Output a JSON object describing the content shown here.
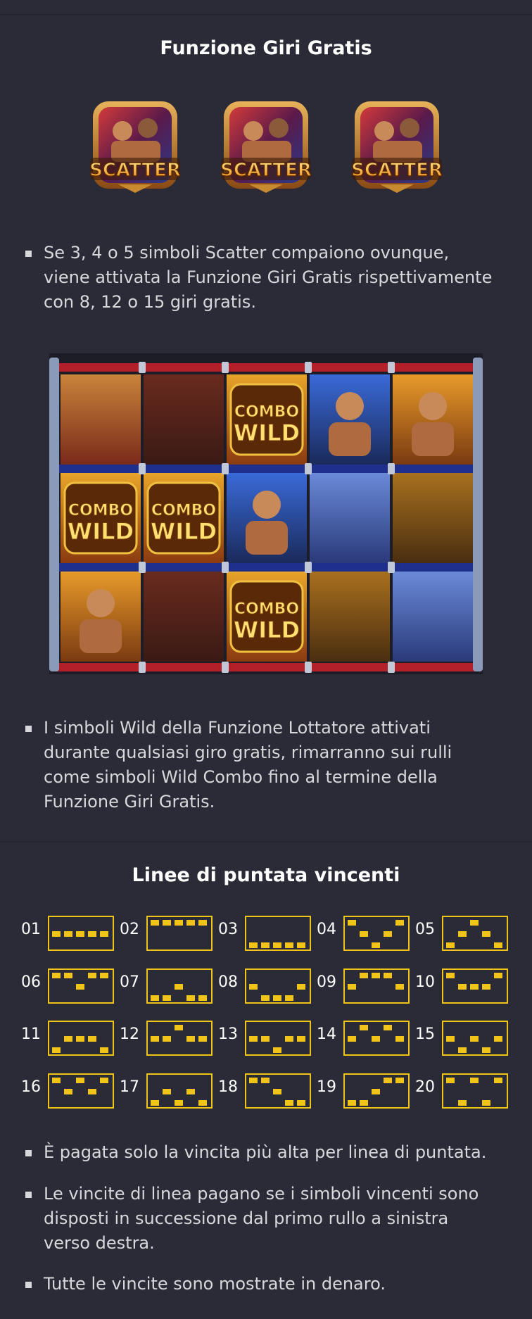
{
  "free_spins": {
    "title": "Funzione Giri Gratis",
    "scatter_symbols": [
      {
        "label": "SCATTER",
        "icon": "scatter-symbol-icon"
      },
      {
        "label": "SCATTER",
        "icon": "scatter-symbol-icon"
      },
      {
        "label": "SCATTER",
        "icon": "scatter-symbol-icon"
      }
    ],
    "bullets": [
      [
        "Se 3, 4 o 5 simboli Scatter compaiono ovunque,",
        "viene attivata la Funzione Giri Gratis rispettivamente",
        "con 8, 12 o 15 giri gratis."
      ],
      [
        "I simboli Wild della Funzione Lottatore attivati",
        "durante qualsiasi giro gratis, rimarranno sui rulli",
        "come simboli Wild Combo fino al termine della",
        "Funzione Giri Gratis."
      ]
    ],
    "reels": {
      "combo_line1": "COMBO",
      "combo_line2": "WILD",
      "grid": [
        [
          "blur-red",
          "blur-dark",
          "wild",
          "fighter-blue",
          "fighter-red"
        ],
        [
          "wild",
          "wild",
          "fighter-blue",
          "blur-blue",
          "blur-gold"
        ],
        [
          "fighter-red",
          "blur-dark",
          "wild",
          "blur-gold",
          "blur-blue"
        ]
      ],
      "colors": {
        "rope_red": "#b3202a",
        "rope_blue": "#1f2f8c",
        "post": "#8a9ab8"
      }
    }
  },
  "paylines": {
    "title": "Linee di puntata vincenti",
    "color": "#f0c419",
    "items": [
      {
        "number": "01",
        "rows": [
          1,
          1,
          1,
          1,
          1
        ]
      },
      {
        "number": "02",
        "rows": [
          0,
          0,
          0,
          0,
          0
        ]
      },
      {
        "number": "03",
        "rows": [
          2,
          2,
          2,
          2,
          2
        ]
      },
      {
        "number": "04",
        "rows": [
          0,
          1,
          2,
          1,
          0
        ]
      },
      {
        "number": "05",
        "rows": [
          2,
          1,
          0,
          1,
          2
        ]
      },
      {
        "number": "06",
        "rows": [
          0,
          0,
          1,
          0,
          0
        ]
      },
      {
        "number": "07",
        "rows": [
          2,
          2,
          1,
          2,
          2
        ]
      },
      {
        "number": "08",
        "rows": [
          1,
          2,
          2,
          2,
          1
        ]
      },
      {
        "number": "09",
        "rows": [
          1,
          0,
          0,
          0,
          1
        ]
      },
      {
        "number": "10",
        "rows": [
          0,
          1,
          1,
          1,
          0
        ]
      },
      {
        "number": "11",
        "rows": [
          2,
          1,
          1,
          1,
          2
        ]
      },
      {
        "number": "12",
        "rows": [
          1,
          1,
          0,
          1,
          1
        ]
      },
      {
        "number": "13",
        "rows": [
          1,
          1,
          2,
          1,
          1
        ]
      },
      {
        "number": "14",
        "rows": [
          1,
          0,
          1,
          0,
          1
        ]
      },
      {
        "number": "15",
        "rows": [
          1,
          2,
          1,
          2,
          1
        ]
      },
      {
        "number": "16",
        "rows": [
          0,
          1,
          0,
          1,
          0
        ]
      },
      {
        "number": "17",
        "rows": [
          2,
          1,
          2,
          1,
          2
        ]
      },
      {
        "number": "18",
        "rows": [
          0,
          0,
          1,
          2,
          2
        ]
      },
      {
        "number": "19",
        "rows": [
          2,
          2,
          1,
          0,
          0
        ]
      },
      {
        "number": "20",
        "rows": [
          0,
          2,
          0,
          2,
          0
        ]
      }
    ],
    "bullets": [
      [
        "È pagata solo la vincita più alta per linea di puntata."
      ],
      [
        "Le vincite di linea pagano se i simboli vincenti sono",
        "disposti in successione dal primo rullo a sinistra",
        "verso destra."
      ],
      [
        "Tutte le vincite sono mostrate in denaro."
      ]
    ]
  }
}
